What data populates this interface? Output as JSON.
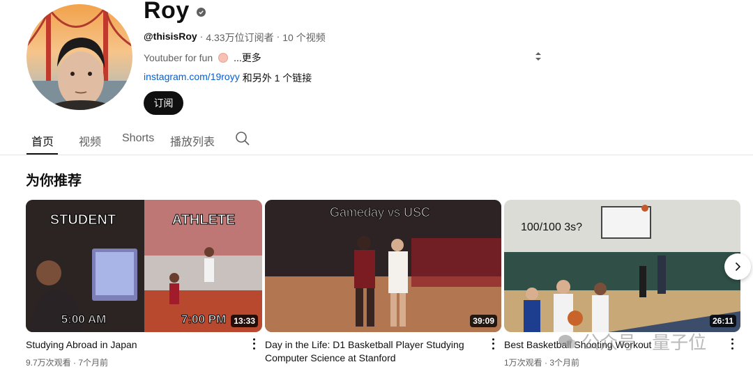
{
  "channel": {
    "name": "Roy",
    "handle": "@thisisRoy",
    "subscribers": "4.33万位订阅者",
    "video_count": "10 个视频",
    "separator": "·",
    "description": "Youtuber for fun",
    "more_label": "...更多",
    "link_text": "instagram.com/19royy",
    "link_suffix": "和另外 1 个链接",
    "subscribe_label": "订阅"
  },
  "tabs": [
    {
      "label": "首页",
      "active": true
    },
    {
      "label": "视频",
      "active": false
    },
    {
      "label": "Shorts",
      "active": false
    },
    {
      "label": "播放列表",
      "active": false
    }
  ],
  "section": {
    "title": "为你推荐"
  },
  "videos": [
    {
      "title": "Studying Abroad in Japan",
      "views": "9.7万次观看",
      "age": "7个月前",
      "duration": "13:33",
      "thumb_texts": [
        "STUDENT",
        "ATHLETE",
        "5:00 AM",
        "7:00 PM"
      ]
    },
    {
      "title": "Day in the Life: D1 Basketball Player Studying Computer Science at Stanford",
      "views": "",
      "age": "",
      "duration": "39:09",
      "thumb_texts": [
        "Gameday vs USC"
      ]
    },
    {
      "title": "Best Basketball Shooting Workout",
      "views": "1万次观看",
      "age": "3个月前",
      "duration": "26:11",
      "thumb_texts": [
        "100/100 3s?"
      ]
    }
  ],
  "watermark": "公众号 · 量子位",
  "icons": {
    "verified": "verified-check-icon",
    "search": "search-icon",
    "next": "chevron-right-icon",
    "sort": "sort-icon",
    "menu": "more-vert-icon"
  }
}
